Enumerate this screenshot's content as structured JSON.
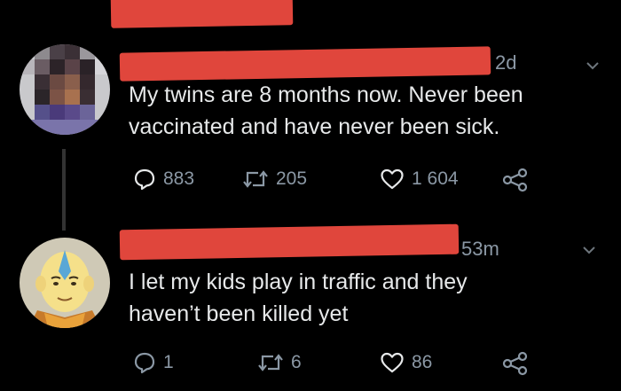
{
  "tweets": [
    {
      "time": "2d",
      "text_line1": "My twins are 8 months now. Never been",
      "text_line2": "vaccinated and have never been sick.",
      "replies": "883",
      "retweets": "205",
      "likes": "1 604",
      "avatar": "pixelated-avatar"
    },
    {
      "time": "53m",
      "text_line1": "I let my kids play in traffic and they",
      "text_line2": "haven’t been killed yet",
      "replies": "1",
      "retweets": "6",
      "likes": "86",
      "avatar": "cartoon-monk-avatar"
    }
  ],
  "icons": [
    "reply-icon",
    "retweet-icon",
    "like-icon",
    "share-icon",
    "chevron-down-icon"
  ],
  "colors": {
    "background": "#000000",
    "redaction": "#e0463c",
    "muted": "#8b98a5",
    "text": "#e7e9ea"
  }
}
